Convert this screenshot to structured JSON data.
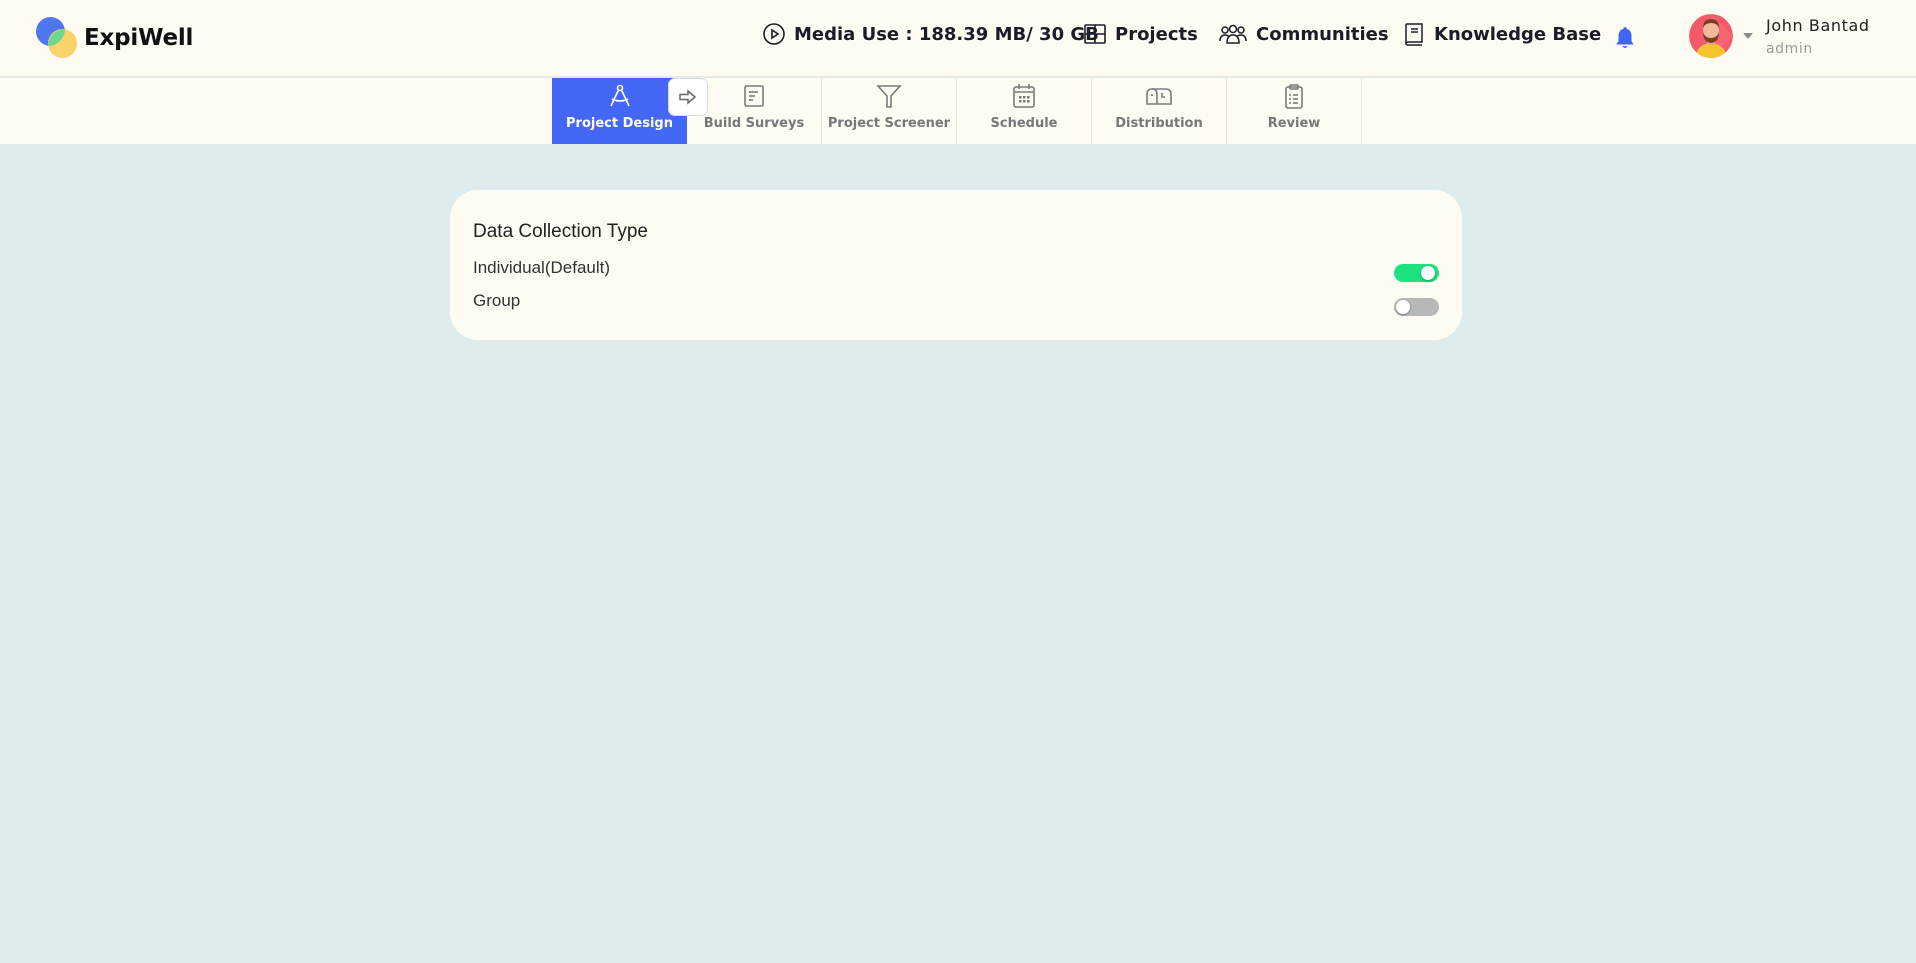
{
  "header": {
    "brand": "ExpiWell",
    "media_use": "Media Use : 188.39 MB/ 30 GB",
    "nav": [
      {
        "label": "Projects",
        "icon": "grid-icon"
      },
      {
        "label": "Communities",
        "icon": "users-icon"
      },
      {
        "label": "Knowledge Base",
        "icon": "book-icon"
      }
    ],
    "notification_icon": "bell-icon",
    "user": {
      "name": "John Bantad",
      "role": "admin"
    }
  },
  "tabs": [
    {
      "label": "Project Design",
      "icon": "compass-icon",
      "active": true
    },
    {
      "label": "Build Surveys",
      "icon": "document-icon",
      "active": false
    },
    {
      "label": "Project Screener",
      "icon": "filter-icon",
      "active": false
    },
    {
      "label": "Schedule",
      "icon": "calendar-icon",
      "active": false
    },
    {
      "label": "Distribution",
      "icon": "mailbox-icon",
      "active": false
    },
    {
      "label": "Review",
      "icon": "clipboard-icon",
      "active": false
    }
  ],
  "card": {
    "title": "Data Collection Type",
    "options": [
      {
        "label": "Individual(Default)",
        "enabled": true
      },
      {
        "label": "Group",
        "enabled": false
      }
    ]
  },
  "colors": {
    "accent": "#4468f5",
    "toggle_on": "#1ce27f",
    "toggle_off": "#b8b8b8",
    "background": "#deeced",
    "surface": "#fefbf3"
  }
}
